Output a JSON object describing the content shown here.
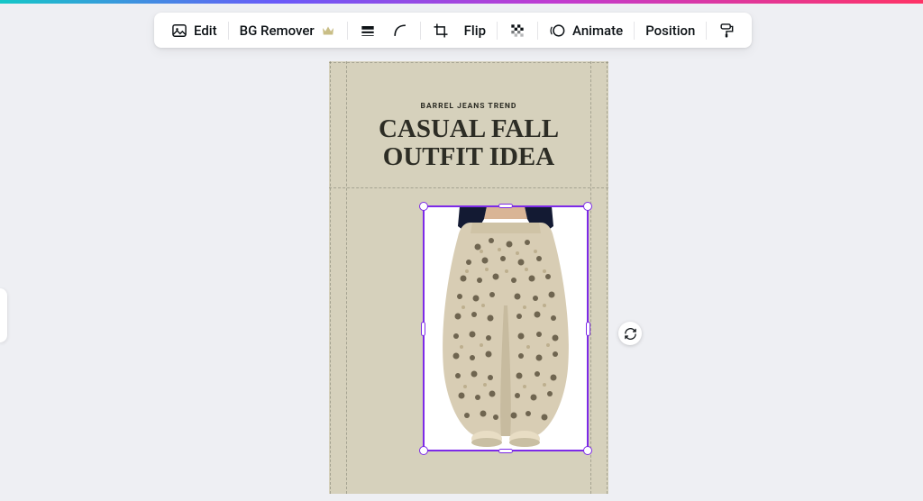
{
  "toolbar": {
    "edit": "Edit",
    "bg_remover": "BG Remover",
    "flip": "Flip",
    "animate": "Animate",
    "position": "Position"
  },
  "canvas": {
    "subheading": "BARREL JEANS TREND",
    "heading_line1": "CASUAL FALL",
    "heading_line2": "OUTFIT IDEA"
  },
  "icons": {
    "edit": "edit-image-icon",
    "bg_remover_crown": "crown-icon",
    "border": "border-weight-icon",
    "corner": "corner-rounding-icon",
    "crop": "crop-icon",
    "flip": "flip-icon",
    "transparency": "transparency-icon",
    "animate": "animate-icon",
    "position": "position-icon",
    "more": "more-paint-roller-icon",
    "replace": "replace-rotate-icon"
  }
}
